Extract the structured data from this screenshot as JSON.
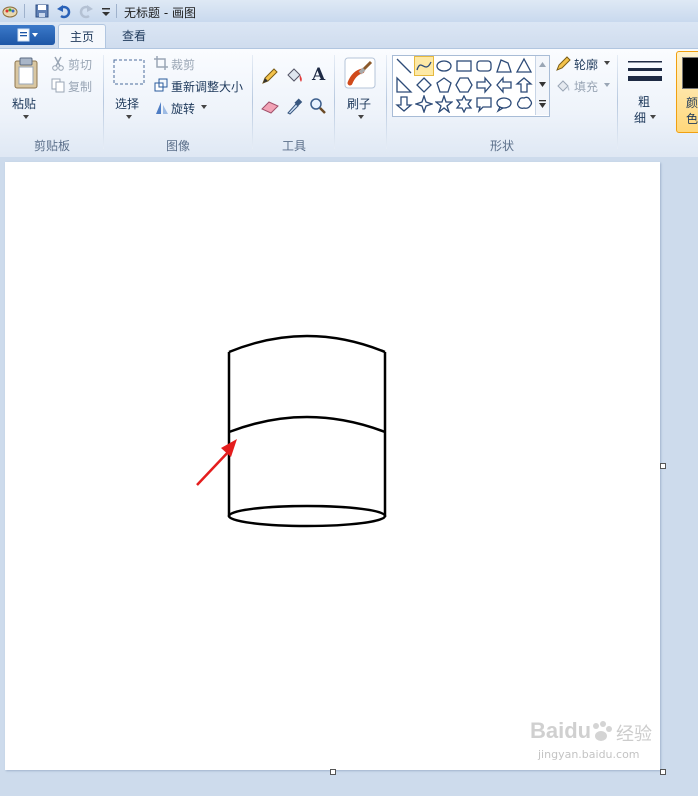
{
  "window": {
    "title": "无标题 - 画图"
  },
  "tabs": [
    {
      "label": "主页"
    },
    {
      "label": "查看"
    }
  ],
  "clipboard": {
    "paste": "粘贴",
    "cut": "剪切",
    "copy": "复制",
    "group": "剪贴板"
  },
  "image": {
    "select": "选择",
    "crop": "裁剪",
    "resize": "重新调整大小",
    "rotate": "旋转",
    "group": "图像"
  },
  "tools": {
    "group": "工具",
    "text_glyph": "A"
  },
  "brushes": {
    "label": "刷子"
  },
  "shapes": {
    "group": "形状",
    "outline": "轮廓",
    "fill": "填充"
  },
  "size": {
    "label_line1": "粗",
    "label_line2": "细"
  },
  "colors": {
    "label_line1": "颜",
    "label_line2": "色",
    "color1": "#000000",
    "accent": "#f0a010"
  },
  "watermark": {
    "brand": "Baidu",
    "brand_cn": "经验",
    "url": "jingyan.baidu.com"
  }
}
